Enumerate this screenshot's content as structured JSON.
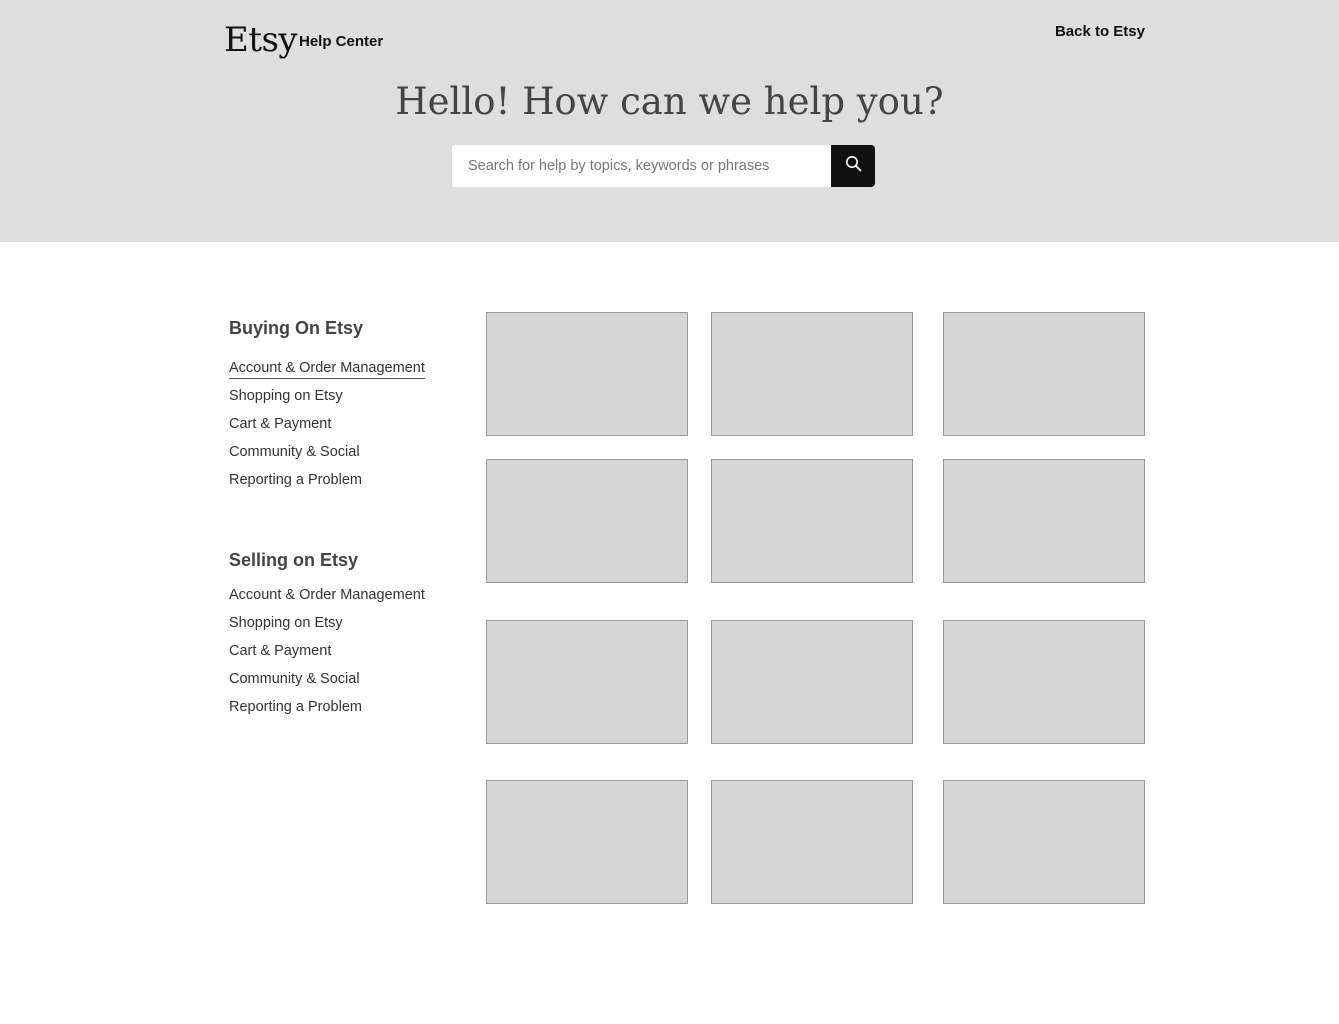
{
  "header": {
    "logo_text": "Etsy",
    "title": "Help Center",
    "back_link": "Back to Etsy"
  },
  "hero": {
    "heading": "Hello! How can we help you?",
    "search_placeholder": "Search for help by topics, keywords or phrases",
    "search_icon": "search-icon"
  },
  "sidebar": {
    "sections": [
      {
        "heading": "Buying On Etsy",
        "items": [
          {
            "label": "Account & Order Management",
            "active": true
          },
          {
            "label": "Shopping on Etsy"
          },
          {
            "label": "Cart & Payment"
          },
          {
            "label": "Community & Social"
          },
          {
            "label": "Reporting a Problem"
          }
        ]
      },
      {
        "heading": "Selling on Etsy",
        "items": [
          {
            "label": "Account & Order Management"
          },
          {
            "label": "Shopping on Etsy"
          },
          {
            "label": "Cart & Payment"
          },
          {
            "label": "Community & Social"
          },
          {
            "label": "Reporting a Problem"
          }
        ]
      }
    ]
  },
  "tiles": {
    "count": 12,
    "color": "#d6d6d6"
  }
}
